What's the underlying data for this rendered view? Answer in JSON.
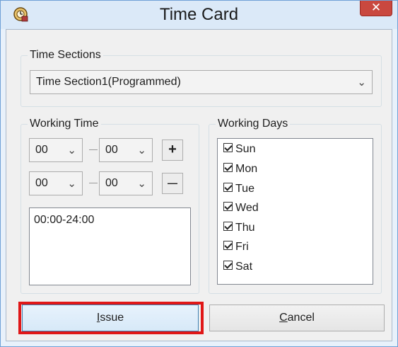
{
  "window": {
    "title": "Time Card",
    "close_label": "✕"
  },
  "time_sections": {
    "legend": "Time Sections",
    "selected": "Time Section1(Programmed)"
  },
  "working_time": {
    "legend": "Working Time",
    "row1": {
      "start": "00",
      "end": "00"
    },
    "row2": {
      "start": "00",
      "end": "00"
    },
    "add_label": "+",
    "remove_label": "—",
    "entries": [
      "00:00-24:00"
    ]
  },
  "working_days": {
    "legend": "Working Days",
    "days": [
      {
        "label": "Sun",
        "checked": true
      },
      {
        "label": "Mon",
        "checked": true
      },
      {
        "label": "Tue",
        "checked": true
      },
      {
        "label": "Wed",
        "checked": true
      },
      {
        "label": "Thu",
        "checked": true
      },
      {
        "label": "Fri",
        "checked": true
      },
      {
        "label": "Sat",
        "checked": true
      }
    ]
  },
  "buttons": {
    "issue_mnemonic": "I",
    "issue_rest": "ssue",
    "cancel_mnemonic": "C",
    "cancel_rest": "ancel"
  },
  "colors": {
    "highlight": "#e01717",
    "close_button": "#c9483f"
  }
}
